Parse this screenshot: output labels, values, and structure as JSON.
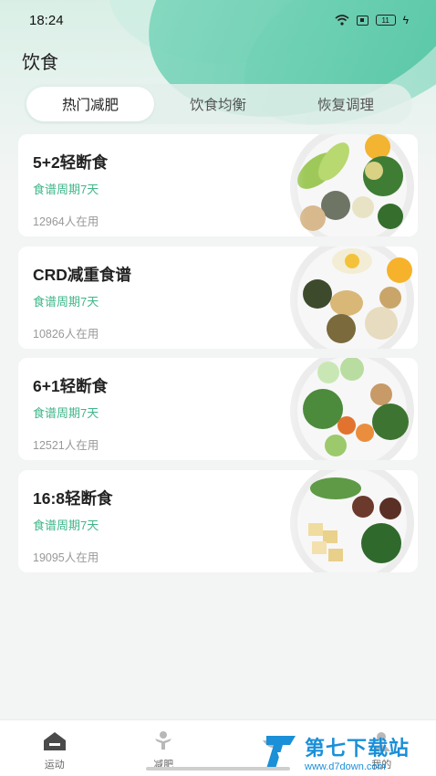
{
  "status_bar": {
    "time": "18:24",
    "battery": "11"
  },
  "header": {
    "title": "饮食"
  },
  "tabs": [
    {
      "label": "热门减肥",
      "active": true
    },
    {
      "label": "饮食均衡",
      "active": false
    },
    {
      "label": "恢复调理",
      "active": false
    }
  ],
  "plans": [
    {
      "title": "5+2轻断食",
      "subtitle": "食谱周期7天",
      "users": "12964人在用"
    },
    {
      "title": "CRD减重食谱",
      "subtitle": "食谱周期7天",
      "users": "10826人在用"
    },
    {
      "title": "6+1轻断食",
      "subtitle": "食谱周期7天",
      "users": "12521人在用"
    },
    {
      "title": "16:8轻断食",
      "subtitle": "食谱周期7天",
      "users": "19095人在用"
    }
  ],
  "bottom_nav": [
    {
      "label": "运动",
      "icon": "home-icon"
    },
    {
      "label": "减肥",
      "icon": "figure-icon"
    },
    {
      "label": "",
      "icon": "food-icon"
    },
    {
      "label": "我的",
      "icon": "profile-icon"
    }
  ],
  "watermark": {
    "text": "第七下载站",
    "url": "www.d7down.com"
  },
  "colors": {
    "accent": "#3fb68a",
    "hero": "#49c29e",
    "watermark": "#1b8fd8"
  }
}
